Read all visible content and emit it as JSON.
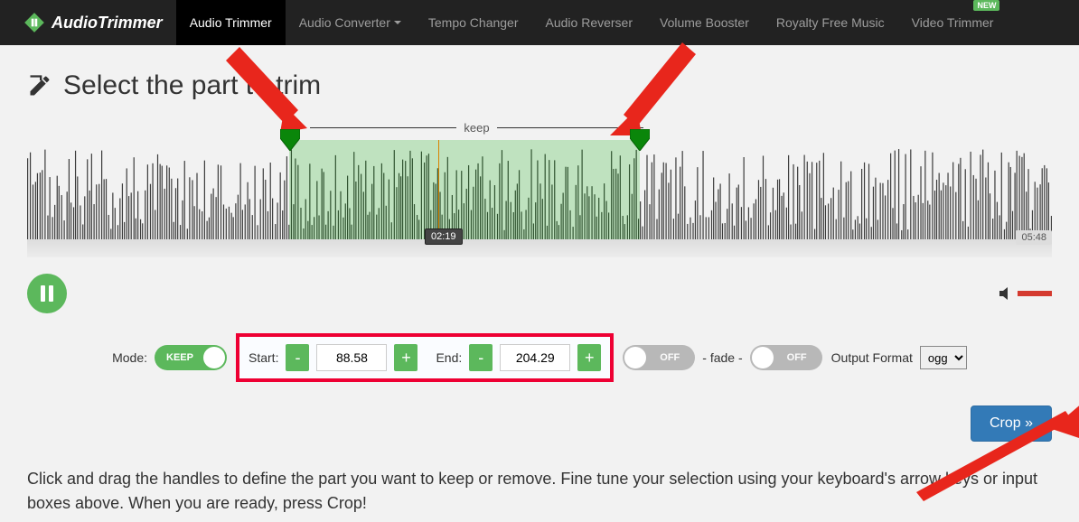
{
  "nav": {
    "brand": "AudioTrimmer",
    "items": [
      {
        "label": "Audio Trimmer",
        "active": true
      },
      {
        "label": "Audio Converter",
        "dropdown": true
      },
      {
        "label": "Tempo Changer"
      },
      {
        "label": "Audio Reverser"
      },
      {
        "label": "Volume Booster"
      },
      {
        "label": "Royalty Free Music"
      },
      {
        "label": "Video Trimmer",
        "new": true
      }
    ],
    "new_badge": "NEW"
  },
  "heading": "Select the part to trim",
  "keep_label": "keep",
  "waveform": {
    "selection_start_pct": 25.5,
    "selection_end_pct": 60,
    "playhead_time": "02:19",
    "total_time": "05:48"
  },
  "controls": {
    "mode_label": "Mode:",
    "mode_value": "KEEP",
    "start_label": "Start:",
    "start_value": "88.58",
    "end_label": "End:",
    "end_value": "204.29",
    "minus": "-",
    "plus": "+",
    "fade_separator": "- fade -",
    "toggle_off": "OFF",
    "output_label": "Output Format",
    "output_value": "ogg"
  },
  "crop_label": "Crop »",
  "instructions": "Click and drag the handles to define the part you want to keep or remove. Fine tune your selection using your keyboard's arrow keys or input boxes above. When you are ready, press Crop!"
}
